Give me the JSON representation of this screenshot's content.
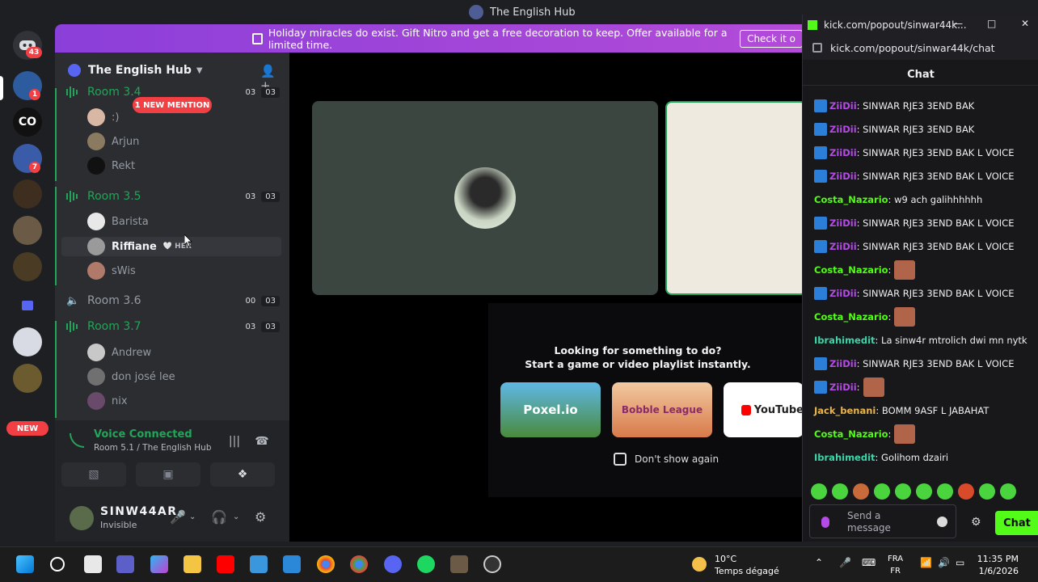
{
  "window": {
    "title": "The English Hub"
  },
  "rail": {
    "dm_badge": "43",
    "server_badge_1": "1",
    "server_co": "CO",
    "server_badge_2": "7",
    "new_label": "NEW"
  },
  "banner": {
    "text": "Holiday miracles do exist. Gift Nitro and get a free decoration to keep. Offer available for a limited time.",
    "button": "Check it o"
  },
  "guild": {
    "name": "The English Hub"
  },
  "mention_pill": "1 NEW MENTION",
  "rooms": [
    {
      "name": "Room 3.4",
      "count_a": "03",
      "count_b": "03",
      "members": [
        ":)",
        "Arjun",
        "Rekt"
      ]
    },
    {
      "name": "Room 3.5",
      "count_a": "03",
      "count_b": "03",
      "members": [
        "Barista",
        "Riffiane",
        "sWis"
      ]
    },
    {
      "name": "Room 3.6",
      "count_a": "00",
      "count_b": "03",
      "members": []
    },
    {
      "name": "Room 3.7",
      "count_a": "03",
      "count_b": "03",
      "members": [
        "Andrew",
        "don josé lee",
        "nix"
      ]
    }
  ],
  "riffiane_tag": "HER",
  "voice": {
    "status": "Voice Connected",
    "location": "Room 5.1 / The English Hub"
  },
  "user": {
    "name": "SINW44AR",
    "status": "Invisible"
  },
  "activity": {
    "title_line1": "Looking for something to do?",
    "title_line2": "Start a game or video playlist instantly.",
    "cards": [
      "Poxel.io",
      "Bobble League",
      "YouTube"
    ],
    "dont_show": "Don't show again"
  },
  "popout": {
    "window_title": "kick.com/popout/sinwar44k...",
    "address": "kick.com/popout/sinwar44k/chat",
    "chat_header": "Chat",
    "messages": [
      {
        "user": "ZiiDii",
        "text": ": SINWAR RJE3 3END BAK",
        "color": "#b44be6",
        "badge": true
      },
      {
        "user": "ZiiDii",
        "text": ": SINWAR RJE3 3END BAK",
        "color": "#b44be6",
        "badge": true
      },
      {
        "user": "ZiiDii",
        "text": ": SINWAR RJE3 3END BAK L VOICE",
        "color": "#b44be6",
        "badge": true
      },
      {
        "user": "ZiiDii",
        "text": ": SINWAR RJE3 3END BAK L VOICE",
        "color": "#b44be6",
        "badge": true
      },
      {
        "user": "Costa_Nazario",
        "text": ": w9 ach galihhhhhh",
        "color": "#53fc18",
        "badge": false
      },
      {
        "user": "ZiiDii",
        "text": ": SINWAR RJE3 3END BAK L VOICE",
        "color": "#b44be6",
        "badge": true
      },
      {
        "user": "ZiiDii",
        "text": ": SINWAR RJE3 3END BAK L VOICE",
        "color": "#b44be6",
        "badge": true
      },
      {
        "user": "Costa_Nazario",
        "text": ":",
        "color": "#53fc18",
        "badge": false,
        "emote": true
      },
      {
        "user": "ZiiDii",
        "text": ": SINWAR RJE3 3END BAK L VOICE",
        "color": "#b44be6",
        "badge": true
      },
      {
        "user": "Costa_Nazario",
        "text": ":",
        "color": "#53fc18",
        "badge": false,
        "emote": true
      },
      {
        "user": "Ibrahimedit",
        "text": ": La sinw4r mtrolich dwi mn nytk",
        "color": "#3fd3a6",
        "badge": false
      },
      {
        "user": "ZiiDii",
        "text": ": SINWAR RJE3 3END BAK L VOICE",
        "color": "#b44be6",
        "badge": true
      },
      {
        "user": "ZiiDii",
        "text": ":",
        "color": "#b44be6",
        "badge": true,
        "emote": true
      },
      {
        "user": "Jack_benani",
        "text": ": BOMM 9ASF L JABAHAT",
        "color": "#e8b44b",
        "badge": false
      },
      {
        "user": "Costa_Nazario",
        "text": ":",
        "color": "#53fc18",
        "badge": false,
        "emote": true
      },
      {
        "user": "Ibrahimedit",
        "text": ": Golihom dzairi",
        "color": "#3fd3a6",
        "badge": false
      }
    ],
    "send_placeholder": "Send a message",
    "chat_button": "Chat"
  },
  "taskbar": {
    "temp": "10°C",
    "weather": "Temps dégagé",
    "lang1": "FRA",
    "lang2": "FR",
    "time": "11:35 PM",
    "date": "1/6/2026"
  }
}
